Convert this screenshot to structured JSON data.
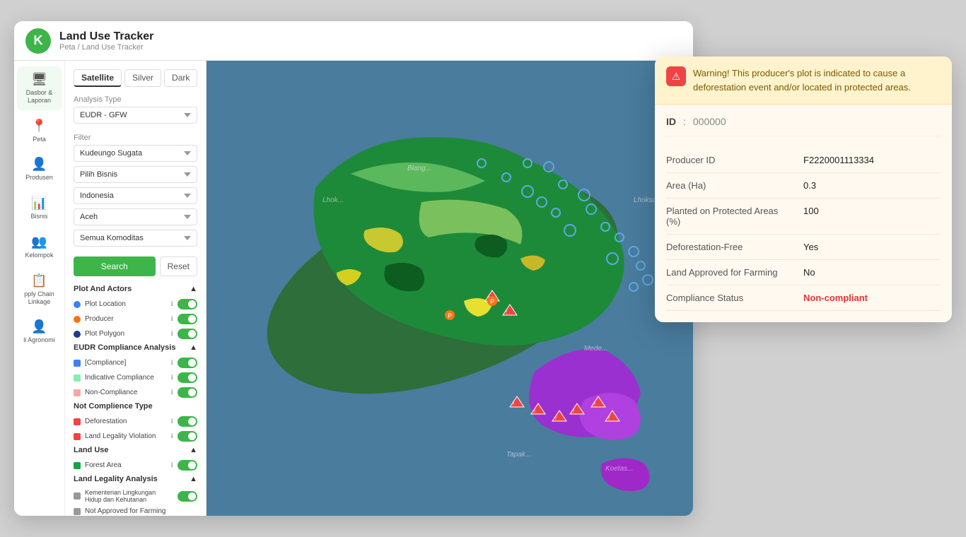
{
  "header": {
    "logo": "K",
    "title": "Land Use Tracker",
    "breadcrumb": "Peta / Land Use Tracker"
  },
  "nav": {
    "items": [
      {
        "id": "dasbor",
        "icon": "🖥",
        "label": "Dasbor &\nLaporan"
      },
      {
        "id": "peta",
        "icon": "📍",
        "label": "Peta"
      },
      {
        "id": "produsen",
        "icon": "👤",
        "label": "Produsen"
      },
      {
        "id": "bisnis",
        "icon": "📊",
        "label": "Bisnis"
      },
      {
        "id": "kelompok",
        "icon": "👥",
        "label": "Kelompok"
      },
      {
        "id": "supply",
        "icon": "📋",
        "label": "pply Chain\nLinkage"
      },
      {
        "id": "agronomi",
        "icon": "👤",
        "label": "li Agronomi"
      }
    ]
  },
  "map_tabs": [
    "Satellite",
    "Silver",
    "Dark"
  ],
  "active_tab": "Satellite",
  "filters": {
    "analysis_type_label": "Analysis Type",
    "analysis_type_value": "EUDR - GFW",
    "filter_label": "Filter",
    "filter_value": "Kudeungo Sugata",
    "pilih_bisnis_value": "Pilih Bisnis",
    "country_value": "Indonesia",
    "region_value": "Aceh",
    "commodity_value": "Semua Komoditas",
    "search_btn": "Search",
    "reset_btn": "Reset"
  },
  "layers": {
    "plot_actors_label": "Plot And Actors",
    "plot_actors": [
      {
        "color": "#3b82f6",
        "name": "Plot Location",
        "type": "dot"
      },
      {
        "color": "#f97316",
        "name": "Producer",
        "type": "dot"
      },
      {
        "color": "#1e3a8a",
        "name": "Plot Polygon",
        "type": "dot"
      }
    ],
    "eudr_label": "EUDR Compliance Analysis",
    "eudr": [
      {
        "color": "#3b82f6",
        "name": "[Compliance]",
        "type": "sq"
      },
      {
        "color": "#86efac",
        "name": "Indicative Compliance",
        "type": "sq"
      },
      {
        "color": "#fca5a5",
        "name": "Non-Compliance",
        "type": "sq"
      }
    ],
    "not_complience_label": "Not Complience Type",
    "not_complience": [
      {
        "color": "#ef4444",
        "name": "Deforestation",
        "type": "sq"
      },
      {
        "color": "#ef4444",
        "name": "Land Legality Violation",
        "type": "sq"
      }
    ],
    "land_use_label": "Land Use",
    "land_use": [
      {
        "color": "#16a34a",
        "name": "Forest Area",
        "type": "sq"
      }
    ],
    "land_legality_label": "Land Legality Analysis",
    "land_legality": [
      {
        "color": "#888",
        "name": "Kementerian Lingkungan Hidup dan Kehutanan",
        "type": "sq"
      },
      {
        "color": "#888",
        "name": "Not Approved for Farming",
        "type": "sq"
      }
    ]
  },
  "popup": {
    "warning_text": "Warning! This producer's plot is indicated to cause a deforestation event and/or located in protected areas.",
    "id_label": "ID",
    "id_value": "000000",
    "fields": [
      {
        "label": "Producer ID",
        "value": "F2220001113334",
        "status": "normal"
      },
      {
        "label": "Area (Ha)",
        "value": "0.3",
        "status": "normal"
      },
      {
        "label": "Planted on Protected Areas (%)",
        "value": "100",
        "status": "normal"
      },
      {
        "label": "Deforestation-Free",
        "value": "Yes",
        "status": "normal"
      },
      {
        "label": "Land Approved for Farming",
        "value": "No",
        "status": "normal"
      },
      {
        "label": "Compliance Status",
        "value": "Non-compliant",
        "status": "non-compliant"
      }
    ]
  }
}
